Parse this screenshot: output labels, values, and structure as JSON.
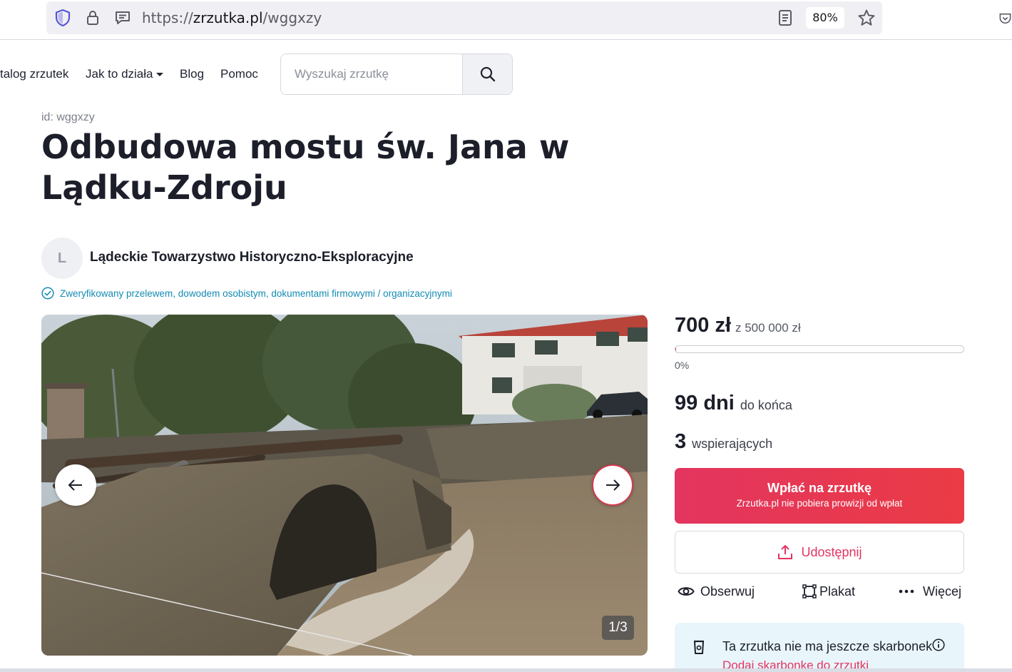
{
  "browser": {
    "url_prefix": "https://",
    "url_domain": "zrzutka.pl",
    "url_path": "/wggxzy",
    "zoom": "80%",
    "icons": [
      "shield-icon",
      "lock-icon",
      "page-info-icon",
      "reader-view-icon",
      "bookmark-star-icon",
      "pocket-icon"
    ]
  },
  "nav": {
    "catalog": "talog zrzutek",
    "how_it_works": "Jak to działa",
    "blog": "Blog",
    "help": "Pomoc",
    "search_placeholder": "Wyszukaj zrzutkę"
  },
  "campaign": {
    "id_label": "id: wggxzy",
    "title": "Odbudowa mostu św. Jana w Lądku-Zdroju",
    "organizer_initial": "L",
    "organizer": "Lądeckie Towarzystwo Historyczno-Eksploracyjne",
    "verified": "Zweryfikowany przelewem, dowodem osobistym, dokumentami firmowymi / organizacyjnymi"
  },
  "gallery": {
    "counter": "1/3"
  },
  "stats": {
    "raised": "700 zł",
    "goal": "z 500 000 zł",
    "progress_fraction": 0.0014,
    "percent": "0%",
    "days": "99 dni",
    "days_suffix": "do końca",
    "supporters": "3",
    "supporters_suffix": "wspierających"
  },
  "actions": {
    "donate": "Wpłać na zrzutkę",
    "donate_sub": "Zrzutka.pl nie pobiera prowizji od wpłat",
    "share": "Udostępnij",
    "watch": "Obserwuj",
    "poster": "Plakat",
    "more": "Więcej"
  },
  "piggy": {
    "text": "Ta zrzutka nie ma jeszcze skarbonek",
    "link": "Dodaj skarbonkę do zrzutki"
  },
  "colors": {
    "accent": "#e8344d",
    "verified": "#138bb3",
    "info_bg": "#e8f5fb"
  }
}
